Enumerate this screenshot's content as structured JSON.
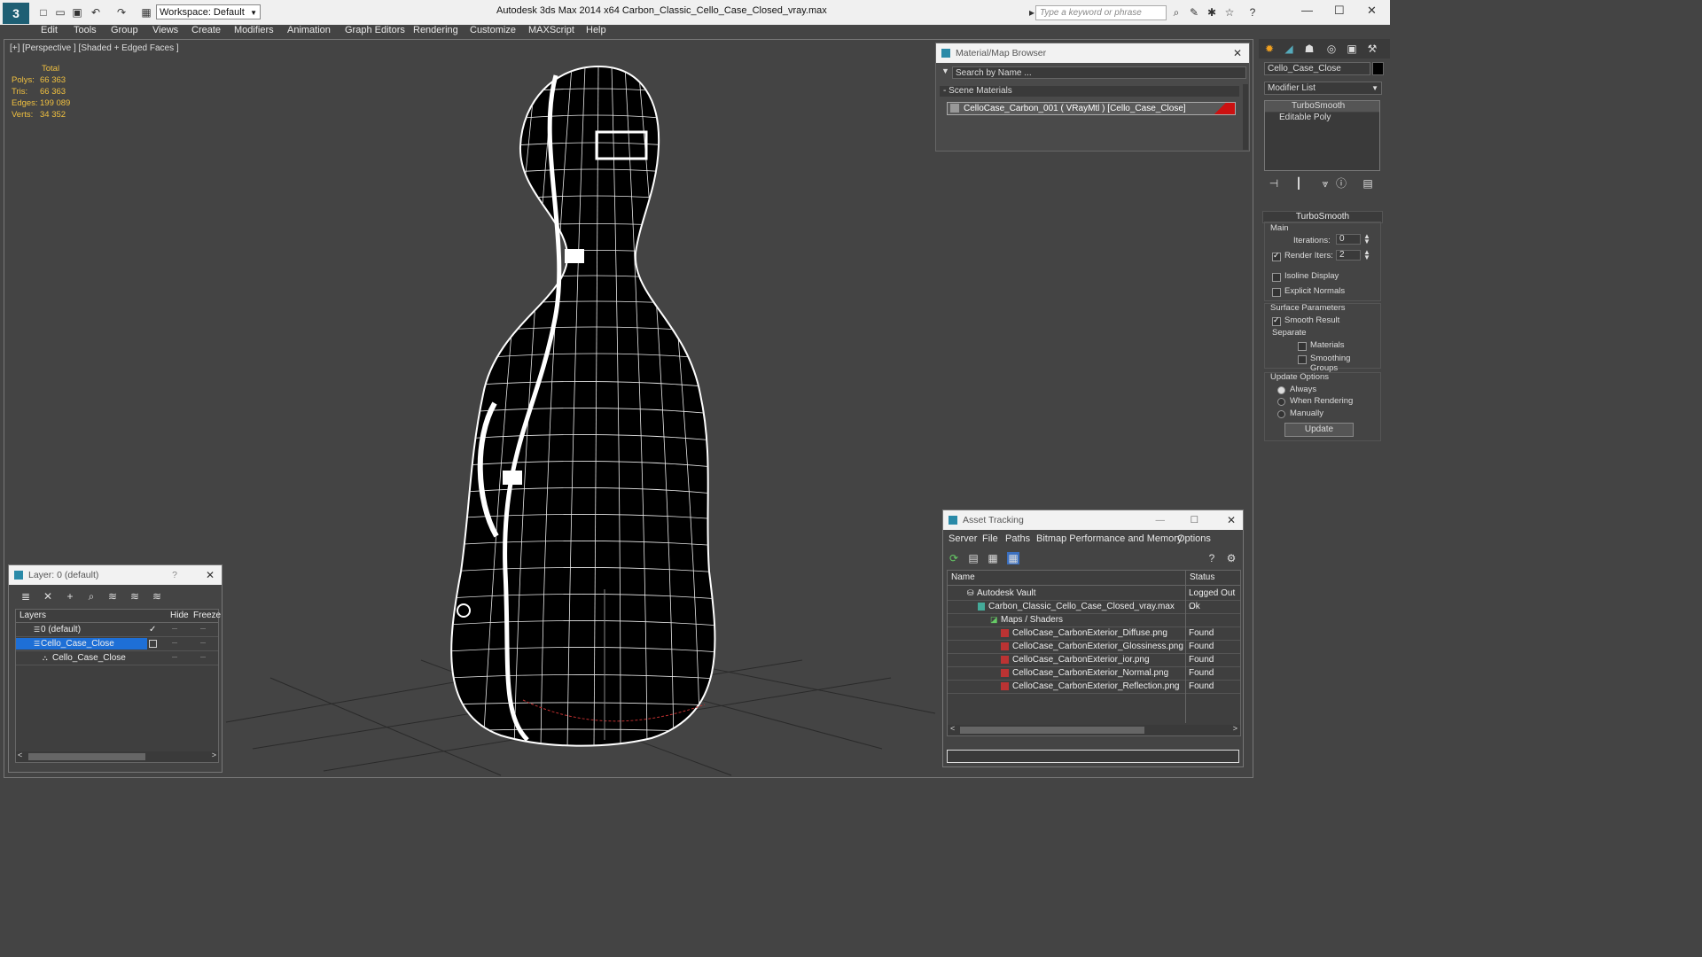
{
  "title_bar": {
    "app_logo": "3",
    "workspace": "Workspace: Default",
    "window_title": "Autodesk 3ds Max  2014 x64     Carbon_Classic_Cello_Case_Closed_vray.max",
    "search_placeholder": "Type a keyword or phrase"
  },
  "menu": [
    "Edit",
    "Tools",
    "Group",
    "Views",
    "Create",
    "Modifiers",
    "Animation",
    "Graph Editors",
    "Rendering",
    "Customize",
    "MAXScript",
    "Help"
  ],
  "viewport": {
    "label": "[+] [Perspective ] [Shaded + Edged Faces ]",
    "stats": {
      "header": "Total",
      "rows": [
        {
          "label": "Polys:",
          "value": "66 363"
        },
        {
          "label": "Tris:",
          "value": "66 363"
        },
        {
          "label": "Edges:",
          "value": "199 089"
        },
        {
          "label": "Verts:",
          "value": "34 352"
        }
      ]
    }
  },
  "material_browser": {
    "title": "Material/Map Browser",
    "search_placeholder": "Search by Name ...",
    "section": "- Scene Materials",
    "material": "CelloCase_Carbon_001  ( VRayMtl ) [Cello_Case_Close]"
  },
  "command_panel": {
    "object_name": "Cello_Case_Close",
    "modifier_list": "Modifier List",
    "stack": [
      "TurboSmooth",
      "Editable Poly"
    ],
    "rollout": "TurboSmooth",
    "main_label": "Main",
    "iterations_label": "Iterations:",
    "iterations": "0",
    "render_iters_label": "Render Iters:",
    "render_iters": "2",
    "isoline": "Isoline Display",
    "explicit_normals": "Explicit Normals",
    "surface_params": "Surface Parameters",
    "smooth_result": "Smooth Result",
    "separate": "Separate",
    "materials": "Materials",
    "smoothing_groups": "Smoothing Groups",
    "update_options": "Update Options",
    "always": "Always",
    "when_rendering": "When Rendering",
    "manually": "Manually",
    "update_button": "Update"
  },
  "layer_window": {
    "title": "Layer: 0 (default)",
    "help": "?",
    "columns": [
      "Layers",
      "Hide",
      "Freeze"
    ],
    "rows": [
      {
        "name": "0 (default)",
        "indent": 1
      },
      {
        "name": "Cello_Case_Close",
        "indent": 1
      },
      {
        "name": "Cello_Case_Close",
        "indent": 2
      }
    ]
  },
  "asset_tracking": {
    "title": "Asset Tracking",
    "menu": [
      "Server",
      "File",
      "Paths",
      "Bitmap Performance and Memory",
      "Options"
    ],
    "columns": [
      "Name",
      "Status"
    ],
    "rows": [
      {
        "name": "Autodesk Vault",
        "status": "Logged Out ..",
        "indent": 1
      },
      {
        "name": "Carbon_Classic_Cello_Case_Closed_vray.max",
        "status": "Ok",
        "indent": 2
      },
      {
        "name": "Maps / Shaders",
        "status": "",
        "indent": 3
      },
      {
        "name": "CelloCase_CarbonExterior_Diffuse.png",
        "status": "Found",
        "indent": 4
      },
      {
        "name": "CelloCase_CarbonExterior_Glossiness.png",
        "status": "Found",
        "indent": 4
      },
      {
        "name": "CelloCase_CarbonExterior_ior.png",
        "status": "Found",
        "indent": 4
      },
      {
        "name": "CelloCase_CarbonExterior_Normal.png",
        "status": "Found",
        "indent": 4
      },
      {
        "name": "CelloCase_CarbonExterior_Reflection.png",
        "status": "Found",
        "indent": 4
      }
    ]
  },
  "colors": {
    "selection": "#1e6fd6",
    "material_swatch": "#cc1111",
    "stats_text": "#f0c040"
  }
}
